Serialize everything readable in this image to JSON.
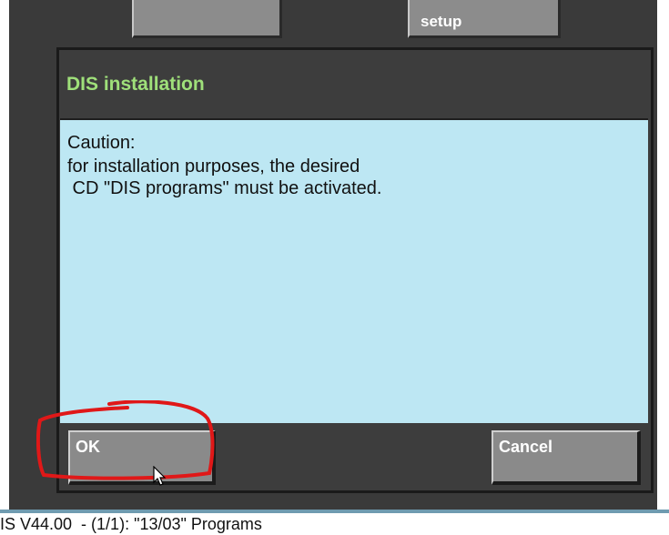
{
  "toolbar": {
    "button_1_label": "",
    "button_2_label": "setup"
  },
  "dialog": {
    "title": "DIS installation",
    "body_lines": [
      "Caution:",
      "for installation purposes, the desired",
      " CD \"DIS programs\" must be activated."
    ],
    "ok_label": "OK",
    "cancel_label": "Cancel"
  },
  "status_bar": {
    "text": "IS V44.00  - (1/1): \"13/03\" Programs"
  },
  "colors": {
    "title_accent": "#9fe07a",
    "body_background": "#bde7f3",
    "annotation": "#e01818"
  }
}
